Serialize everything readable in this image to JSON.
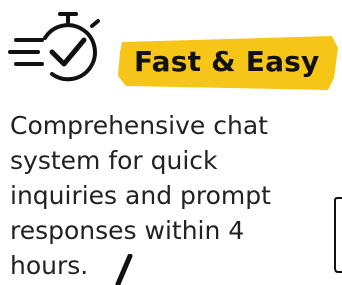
{
  "feature": {
    "icon": "stopwatch-check-icon",
    "title": "Fast & Easy",
    "description_lines": [
      "Comprehensive chat",
      "system for quick",
      "inquiries and prompt",
      "responses within 4",
      "hours."
    ]
  },
  "colors": {
    "highlight": "#F5C518",
    "text": "#111111"
  }
}
